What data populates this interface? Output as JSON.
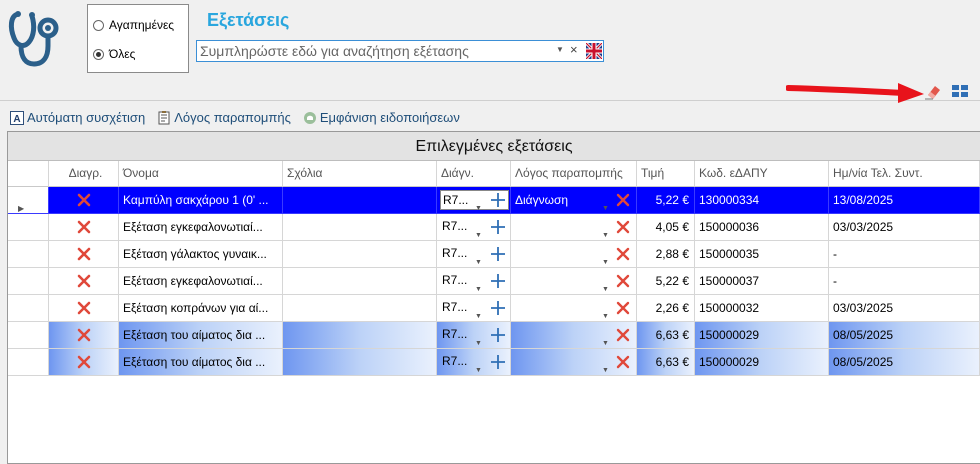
{
  "header": {
    "title": "Εξετάσεις",
    "filter_options": [
      {
        "label": "Αγαπημένες",
        "selected": false
      },
      {
        "label": "Όλες",
        "selected": true
      }
    ],
    "search": {
      "placeholder": "Συμπληρώστε εδώ για αναζήτηση εξέτασης",
      "value": ""
    },
    "clear_symbol": "×"
  },
  "toolbar": {
    "auto_match": "Αυτόματη συσχέτιση",
    "referral_reason": "Λόγος παραπομπής",
    "show_notifications": "Εμφάνιση ειδοποιήσεων"
  },
  "grid": {
    "title": "Επιλεγμένες εξετάσεις",
    "columns": [
      "Διαγρ.",
      "Όνομα",
      "Σχόλια",
      "Διάγν.",
      "Λόγος παραπομπής",
      "Τιμή",
      "Κωδ. εΔΑΠΥ",
      "Ημ/νία Τελ. Συντ."
    ],
    "rows": [
      {
        "name": "Καμπύλη σακχάρου 1 (0' ...",
        "comments": "",
        "diagnosis": "R7...",
        "reason": "Διάγνωση",
        "price": "5,22 €",
        "code": "130000334",
        "date": "13/08/2025",
        "state": "selected"
      },
      {
        "name": "Εξέταση εγκεφαλονωτιαί...",
        "comments": "",
        "diagnosis": "R7...",
        "reason": "",
        "price": "4,05 €",
        "code": "150000036",
        "date": "03/03/2025",
        "state": "normal"
      },
      {
        "name": "Εξέταση γάλακτος γυναικ...",
        "comments": "",
        "diagnosis": "R7...",
        "reason": "",
        "price": "2,88 €",
        "code": "150000035",
        "date": "-",
        "state": "normal"
      },
      {
        "name": "Εξέταση εγκεφαλονωτιαί...",
        "comments": "",
        "diagnosis": "R7...",
        "reason": "",
        "price": "5,22 €",
        "code": "150000037",
        "date": "-",
        "state": "normal"
      },
      {
        "name": "Εξέταση κοπράνων για αί...",
        "comments": "",
        "diagnosis": "R7...",
        "reason": "",
        "price": "2,26 €",
        "code": "150000032",
        "date": "03/03/2025",
        "state": "normal"
      },
      {
        "name": "Εξέταση του αίματος δια ...",
        "comments": "",
        "diagnosis": "R7...",
        "reason": "",
        "price": "6,63 €",
        "code": "150000029",
        "date": "08/05/2025",
        "state": "highlight"
      },
      {
        "name": "Εξέταση του αίματος δια ...",
        "comments": "",
        "diagnosis": "R7...",
        "reason": "",
        "price": "6,63 €",
        "code": "150000029",
        "date": "08/05/2025",
        "state": "highlight"
      }
    ]
  },
  "colors": {
    "title": "#29a6de",
    "selected_row": "#0000ff",
    "delete": "#e0483a",
    "plus": "#2f6fb5",
    "arrow": "#e8131b"
  },
  "icons": [
    "stethoscope-icon",
    "uk-flag-icon",
    "eraser-icon",
    "grid-layout-icon",
    "auto-match-icon",
    "document-icon",
    "notification-icon",
    "delete-icon",
    "add-icon"
  ]
}
